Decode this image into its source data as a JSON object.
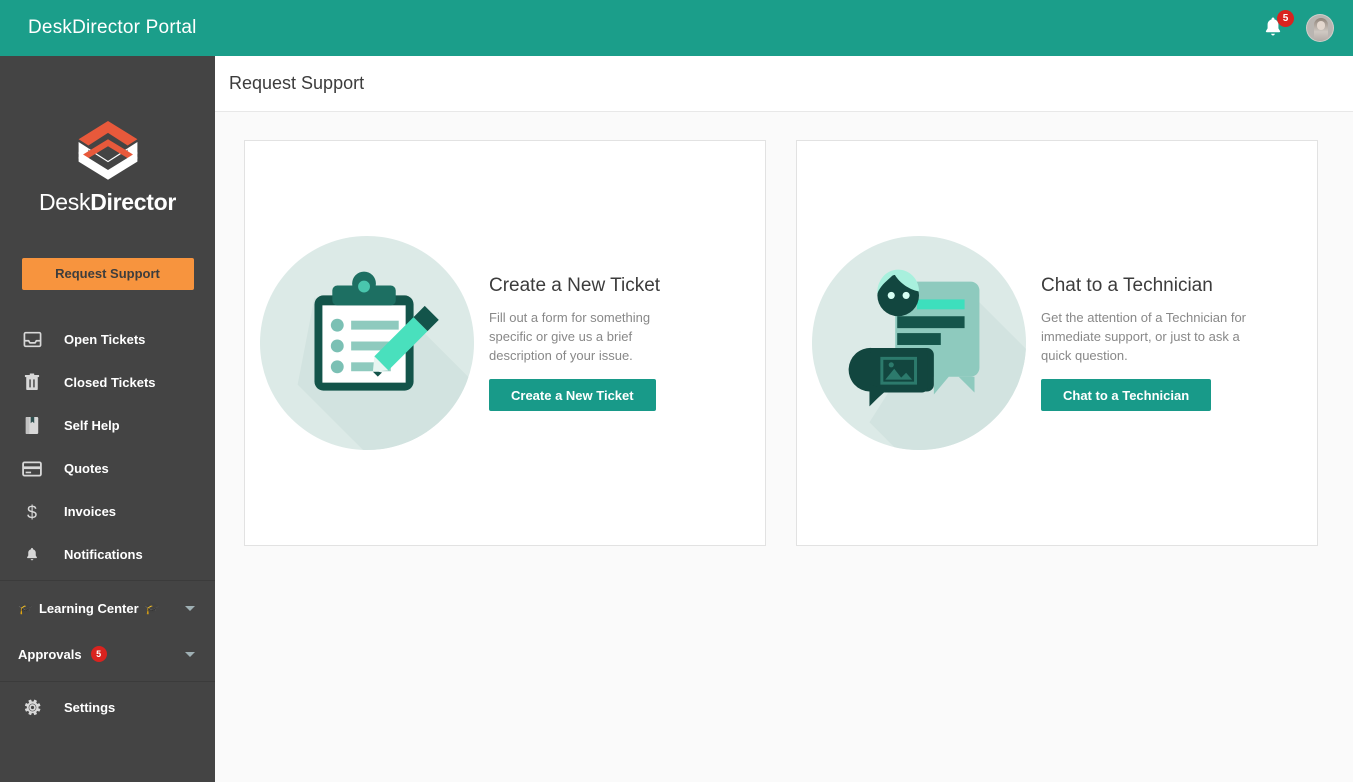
{
  "header": {
    "title": "DeskDirector Portal",
    "notifications_badge": "5",
    "bell_icon": "bell-icon",
    "avatar_icon": "user-avatar"
  },
  "sidebar": {
    "logo": {
      "icon": "deskdirector-logo-mark",
      "text_light": "Desk",
      "text_bold": "Director"
    },
    "request_support_label": "Request Support",
    "items": [
      {
        "label": "Open Tickets",
        "icon": "inbox-tray-icon"
      },
      {
        "label": "Closed Tickets",
        "icon": "trash-can-icon"
      },
      {
        "label": "Self Help",
        "icon": "book-bookmark-icon"
      },
      {
        "label": "Quotes",
        "icon": "credit-card-icon"
      },
      {
        "label": "Invoices",
        "icon": "dollar-sign-icon"
      },
      {
        "label": "Notifications",
        "icon": "bell-icon"
      }
    ],
    "groups": [
      {
        "label": "Learning Center",
        "emoji_left": "🎓",
        "emoji_right": "🎓",
        "badge": "",
        "chevron": "chevron-down-icon"
      },
      {
        "label": "Approvals",
        "emoji_left": "",
        "emoji_right": "",
        "badge": "5",
        "chevron": "chevron-down-icon"
      }
    ],
    "settings": {
      "label": "Settings",
      "icon": "gear-icon"
    }
  },
  "main": {
    "page_title": "Request Support",
    "cards": [
      {
        "title": "Create a New Ticket",
        "description": "Fill out a form for something specific or give us a brief description of your issue.",
        "button_label": "Create a New Ticket",
        "art": "clipboard-checklist-pencil-illustration"
      },
      {
        "title": "Chat to a Technician",
        "description": "Get the attention of a Technician for immediate support, or just to ask a quick question.",
        "button_label": "Chat to a Technician",
        "art": "chat-bubbles-illustration"
      }
    ]
  },
  "colors": {
    "header_teal": "#1b9e8a",
    "sidebar_dark": "#444444",
    "accent_orange": "#f7943e",
    "button_teal": "#189a89",
    "badge_red": "#d9231f",
    "page_background": "#fafafa"
  }
}
